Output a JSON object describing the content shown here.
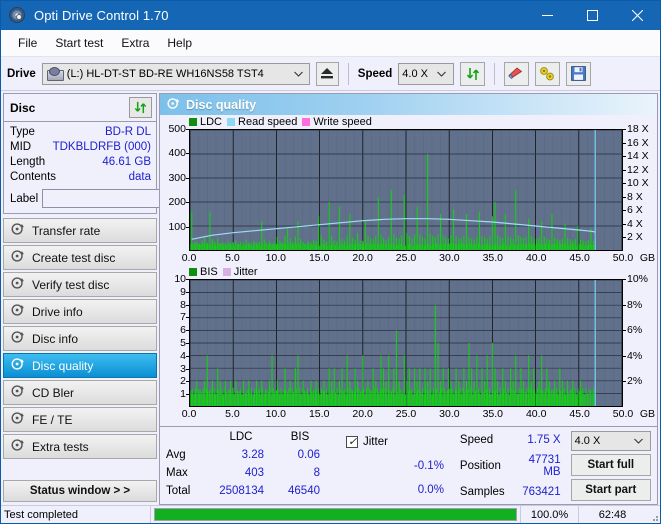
{
  "window": {
    "title": "Opti Drive Control 1.70",
    "icon": "disc-icon",
    "minimize": "minimize-icon",
    "maximize": "maximize-icon",
    "close": "close-icon"
  },
  "menu": {
    "items": [
      "File",
      "Start test",
      "Extra",
      "Help"
    ]
  },
  "toolbar": {
    "drive_label": "Drive",
    "drive_value": "(L:)   HL-DT-ST BD-RE  WH16NS58 TST4",
    "eject_icon": "eject-icon",
    "speed_label": "Speed",
    "speed_value": "4.0 X",
    "refresh_icon": "refresh-arrows-icon",
    "erase_icon": "eraser-icon",
    "tools_icon": "wrench-icon",
    "save_icon": "floppy-save-icon"
  },
  "disc_panel": {
    "title": "Disc",
    "refresh_icon": "refresh-arrows-icon",
    "rows": [
      {
        "key": "Type",
        "value": "BD-R DL"
      },
      {
        "key": "MID",
        "value": "TDKBLDRFB (000)"
      },
      {
        "key": "Length",
        "value": "46.61 GB"
      },
      {
        "key": "Contents",
        "value": "data"
      }
    ],
    "label_key": "Label",
    "label_value": "",
    "label_placeholder": "",
    "label_button_icon": "disc-icon"
  },
  "sidebar": {
    "items": [
      {
        "label": "Transfer rate",
        "icon": "disc-test-icon",
        "active": false
      },
      {
        "label": "Create test disc",
        "icon": "disc-test-icon",
        "active": false
      },
      {
        "label": "Verify test disc",
        "icon": "disc-test-icon",
        "active": false
      },
      {
        "label": "Drive info",
        "icon": "disc-info-icon",
        "active": false
      },
      {
        "label": "Disc info",
        "icon": "disc-info-icon",
        "active": false
      },
      {
        "label": "Disc quality",
        "icon": "disc-quality-icon",
        "active": true
      },
      {
        "label": "CD Bler",
        "icon": "disc-test-icon",
        "active": false
      },
      {
        "label": "FE / TE",
        "icon": "disc-test-icon",
        "active": false
      },
      {
        "label": "Extra tests",
        "icon": "disc-test-icon",
        "active": false
      }
    ],
    "status_button": "Status window > >"
  },
  "main": {
    "title": "Disc quality",
    "title_icon": "disc-quality-icon"
  },
  "chart_data": [
    {
      "type": "bar",
      "name": "ldc-chart",
      "title": "",
      "legend": [
        {
          "label": "LDC",
          "color": "#0f8f0f"
        },
        {
          "label": "Read speed",
          "color": "#8fd8f5"
        },
        {
          "label": "Write speed",
          "color": "#ff6ee0"
        }
      ],
      "legend_position": "top-left",
      "grid": true,
      "plot_bg": "#61718c",
      "xlabel": "GB",
      "xlim": [
        0,
        50
      ],
      "xticks": [
        0.0,
        5.0,
        10.0,
        15.0,
        20.0,
        25.0,
        30.0,
        35.0,
        40.0,
        45.0,
        50.0
      ],
      "xticklabels": [
        "0.0",
        "5.0",
        "10.0",
        "15.0",
        "20.0",
        "25.0",
        "30.0",
        "35.0",
        "40.0",
        "45.0",
        "50.0"
      ],
      "ylabel": "",
      "ylim": [
        0,
        500
      ],
      "yticks": [
        100,
        200,
        300,
        400,
        500
      ],
      "yticklabels": [
        "100",
        "200",
        "300",
        "400",
        "500"
      ],
      "y2label": "",
      "y2lim": [
        0,
        18
      ],
      "y2ticks": [
        2,
        4,
        6,
        8,
        10,
        12,
        14,
        16,
        18
      ],
      "y2ticklabels": [
        "2 X",
        "4 X",
        "6 X",
        "8 X",
        "10 X",
        "12 X",
        "14 X",
        "16 X",
        "18 X"
      ],
      "series": [
        {
          "name": "LDC",
          "color": "#12d012",
          "type": "bar",
          "x": [
            0.2,
            0.5,
            0.8,
            1.1,
            1.4,
            1.7,
            2.0,
            2.3,
            2.6,
            2.9,
            3.2,
            3.5,
            3.8,
            4.1,
            4.4,
            4.7,
            5.0,
            5.3,
            5.6,
            5.9,
            6.2,
            6.5,
            6.8,
            7.1,
            7.4,
            7.7,
            8.0,
            8.3,
            8.6,
            8.9,
            9.2,
            9.5,
            9.8,
            10.1,
            10.4,
            10.7,
            11.0,
            11.3,
            11.6,
            11.9,
            12.2,
            12.5,
            12.8,
            13.1,
            13.4,
            13.7,
            14.0,
            14.3,
            14.6,
            14.9,
            15.2,
            15.5,
            15.8,
            16.1,
            16.4,
            16.7,
            17.0,
            17.3,
            17.6,
            17.9,
            18.2,
            18.5,
            18.8,
            19.1,
            19.4,
            19.7,
            20.0,
            20.3,
            20.6,
            20.9,
            21.2,
            21.5,
            21.8,
            22.1,
            22.4,
            22.7,
            23.0,
            23.3,
            23.6,
            23.9,
            24.2,
            24.5,
            24.8,
            25.1,
            25.4,
            25.7,
            26.0,
            26.3,
            26.6,
            26.9,
            27.2,
            27.5,
            27.8,
            28.1,
            28.4,
            28.7,
            29.0,
            29.3,
            29.6,
            29.9,
            30.2,
            30.5,
            30.8,
            31.1,
            31.4,
            31.7,
            32.0,
            32.3,
            32.6,
            32.9,
            33.2,
            33.5,
            33.8,
            34.1,
            34.4,
            34.7,
            35.0,
            35.3,
            35.6,
            35.9,
            36.2,
            36.5,
            36.8,
            37.1,
            37.4,
            37.7,
            38.0,
            38.3,
            38.6,
            38.9,
            39.2,
            39.5,
            39.8,
            40.1,
            40.4,
            40.7,
            41.0,
            41.3,
            41.6,
            41.9,
            42.2,
            42.5,
            42.8,
            43.1,
            43.4,
            43.7,
            44.0,
            44.3,
            44.6,
            44.9,
            45.2,
            45.5,
            45.8,
            46.1,
            46.4,
            46.7
          ],
          "values": [
            160,
            30,
            35,
            25,
            40,
            55,
            30,
            160,
            45,
            35,
            50,
            28,
            30,
            26,
            36,
            30,
            32,
            40,
            28,
            34,
            26,
            44,
            30,
            28,
            38,
            30,
            34,
            120,
            45,
            30,
            38,
            26,
            30,
            55,
            40,
            32,
            60,
            95,
            48,
            35,
            55,
            120,
            46,
            34,
            28,
            36,
            30,
            42,
            38,
            140,
            60,
            44,
            36,
            200,
            58,
            40,
            36,
            180,
            46,
            38,
            60,
            150,
            52,
            44,
            70,
            40,
            38,
            120,
            60,
            48,
            44,
            58,
            220,
            62,
            50,
            42,
            56,
            250,
            66,
            52,
            48,
            60,
            230,
            70,
            58,
            50,
            64,
            180,
            62,
            54,
            48,
            400,
            70,
            58,
            52,
            66,
            150,
            60,
            54,
            48,
            62,
            170,
            58,
            50,
            46,
            58,
            150,
            54,
            48,
            44,
            56,
            160,
            60,
            52,
            46,
            58,
            140,
            200,
            62,
            54,
            48,
            150,
            58,
            52,
            46,
            250,
            60,
            54,
            48,
            56,
            130,
            58,
            50,
            46,
            52,
            120,
            56,
            48,
            44,
            150,
            52,
            46,
            42,
            48,
            110,
            50,
            44,
            40,
            46,
            100,
            44,
            40,
            36,
            42,
            90,
            38
          ]
        },
        {
          "name": "Read speed",
          "color": "#9fdcf7",
          "type": "line",
          "axis": "y2",
          "x": [
            0.2,
            2.5,
            5.0,
            7.5,
            10.0,
            12.5,
            15.0,
            17.5,
            20.0,
            22.5,
            25.0,
            27.5,
            30.0,
            32.5,
            35.0,
            37.5,
            40.0,
            42.5,
            45.0,
            46.5,
            46.9
          ],
          "values": [
            1.6,
            2.2,
            2.6,
            2.9,
            3.2,
            3.5,
            3.8,
            4.1,
            4.4,
            4.6,
            4.7,
            4.7,
            4.6,
            4.4,
            4.2,
            3.9,
            3.6,
            3.3,
            3.0,
            2.8,
            2.7
          ]
        }
      ]
    },
    {
      "type": "bar",
      "name": "bis-chart",
      "title": "",
      "legend": [
        {
          "label": "BIS",
          "color": "#0f8f0f"
        },
        {
          "label": "Jitter",
          "color": "#d9aee0"
        }
      ],
      "legend_position": "top-left",
      "grid": true,
      "plot_bg": "#61718c",
      "xlabel": "GB",
      "xlim": [
        0,
        50
      ],
      "xticks": [
        0.0,
        5.0,
        10.0,
        15.0,
        20.0,
        25.0,
        30.0,
        35.0,
        40.0,
        45.0,
        50.0
      ],
      "xticklabels": [
        "0.0",
        "5.0",
        "10.0",
        "15.0",
        "20.0",
        "25.0",
        "30.0",
        "35.0",
        "40.0",
        "45.0",
        "50.0"
      ],
      "ylabel": "",
      "ylim": [
        0,
        10
      ],
      "yticks": [
        1,
        2,
        3,
        4,
        5,
        6,
        7,
        8,
        9,
        10
      ],
      "yticklabels": [
        "1",
        "2",
        "3",
        "4",
        "5",
        "6",
        "7",
        "8",
        "9",
        "10"
      ],
      "y2label": "",
      "y2lim": [
        0,
        10
      ],
      "y2ticks": [
        2,
        4,
        6,
        8,
        10
      ],
      "y2ticklabels": [
        "2%",
        "4%",
        "6%",
        "8%",
        "10%"
      ],
      "series": [
        {
          "name": "BIS",
          "color": "#12d012",
          "type": "bar",
          "x": [
            0.2,
            0.5,
            0.8,
            1.1,
            1.4,
            1.7,
            2.0,
            2.3,
            2.6,
            2.9,
            3.2,
            3.5,
            3.8,
            4.1,
            4.4,
            4.7,
            5.0,
            5.3,
            5.6,
            5.9,
            6.2,
            6.5,
            6.8,
            7.1,
            7.4,
            7.7,
            8.0,
            8.3,
            8.6,
            8.9,
            9.2,
            9.5,
            9.8,
            10.1,
            10.4,
            10.7,
            11.0,
            11.3,
            11.6,
            11.9,
            12.2,
            12.5,
            12.8,
            13.1,
            13.4,
            13.7,
            14.0,
            14.3,
            14.6,
            14.9,
            15.2,
            15.5,
            15.8,
            16.1,
            16.4,
            16.7,
            17.0,
            17.3,
            17.6,
            17.9,
            18.2,
            18.5,
            18.8,
            19.1,
            19.4,
            19.7,
            20.0,
            20.3,
            20.6,
            20.9,
            21.2,
            21.5,
            21.8,
            22.1,
            22.4,
            22.7,
            23.0,
            23.3,
            23.6,
            23.9,
            24.2,
            24.5,
            24.8,
            25.1,
            25.4,
            25.7,
            26.0,
            26.3,
            26.6,
            26.9,
            27.2,
            27.5,
            27.8,
            28.1,
            28.4,
            28.7,
            29.0,
            29.3,
            29.6,
            29.9,
            30.2,
            30.5,
            30.8,
            31.1,
            31.4,
            31.7,
            32.0,
            32.3,
            32.6,
            32.9,
            33.2,
            33.5,
            33.8,
            34.1,
            34.4,
            34.7,
            35.0,
            35.3,
            35.6,
            35.9,
            36.2,
            36.5,
            36.8,
            37.1,
            37.4,
            37.7,
            38.0,
            38.3,
            38.6,
            38.9,
            39.2,
            39.5,
            39.8,
            40.1,
            40.4,
            40.7,
            41.0,
            41.3,
            41.6,
            41.9,
            42.2,
            42.5,
            42.8,
            43.1,
            43.4,
            43.7,
            44.0,
            44.3,
            44.6,
            44.9,
            45.2,
            45.5,
            45.8,
            46.1,
            46.4,
            46.7
          ],
          "values": [
            1,
            1,
            2,
            1,
            1,
            2,
            4,
            1,
            2,
            1,
            3,
            2,
            1,
            2,
            1,
            2,
            1,
            2,
            1,
            1,
            2,
            1,
            2,
            1,
            1,
            2,
            1,
            2,
            1,
            1,
            2,
            4,
            1,
            2,
            1,
            1,
            3,
            1,
            2,
            1,
            3,
            4,
            1,
            2,
            1,
            1,
            2,
            1,
            2,
            1,
            1,
            2,
            1,
            3,
            2,
            3,
            1,
            2,
            3,
            1,
            4,
            2,
            1,
            3,
            2,
            1,
            4,
            1,
            2,
            1,
            3,
            2,
            1,
            4,
            3,
            2,
            4,
            1,
            3,
            6,
            2,
            1,
            4,
            2,
            3,
            1,
            3,
            2,
            3,
            1,
            3,
            2,
            3,
            1,
            8,
            5,
            2,
            3,
            1,
            3,
            2,
            1,
            3,
            2,
            1,
            3,
            2,
            5,
            3,
            2,
            4,
            1,
            3,
            2,
            4,
            1,
            5,
            3,
            2,
            1,
            3,
            2,
            1,
            3,
            2,
            4,
            1,
            3,
            2,
            1,
            4,
            2,
            3,
            1,
            2,
            4,
            1,
            3,
            2,
            1,
            2,
            1,
            3,
            2,
            1,
            2,
            1,
            2,
            1,
            1,
            2,
            1
          ]
        }
      ]
    }
  ],
  "stats": {
    "columns": [
      "LDC",
      "BIS"
    ],
    "rows": [
      {
        "label": "Avg",
        "ldc": "3.28",
        "bis": "0.06"
      },
      {
        "label": "Max",
        "ldc": "403",
        "bis": "8"
      },
      {
        "label": "Total",
        "ldc": "2508134",
        "bis": "46540"
      }
    ],
    "jitter": {
      "label": "Jitter",
      "checked": true,
      "avg": "-0.1%",
      "max": "0.0%"
    },
    "speed": {
      "label": "Speed",
      "value": "1.75 X"
    },
    "position": {
      "label": "Position",
      "value": "47731 MB"
    },
    "samples": {
      "label": "Samples",
      "value": "763421"
    },
    "speed_select": "4.0 X",
    "start_full": "Start full",
    "start_part": "Start part"
  },
  "statusbar": {
    "message": "Test completed",
    "progress_percent": 100,
    "progress_label": "100.0%",
    "elapsed": "62:48"
  }
}
